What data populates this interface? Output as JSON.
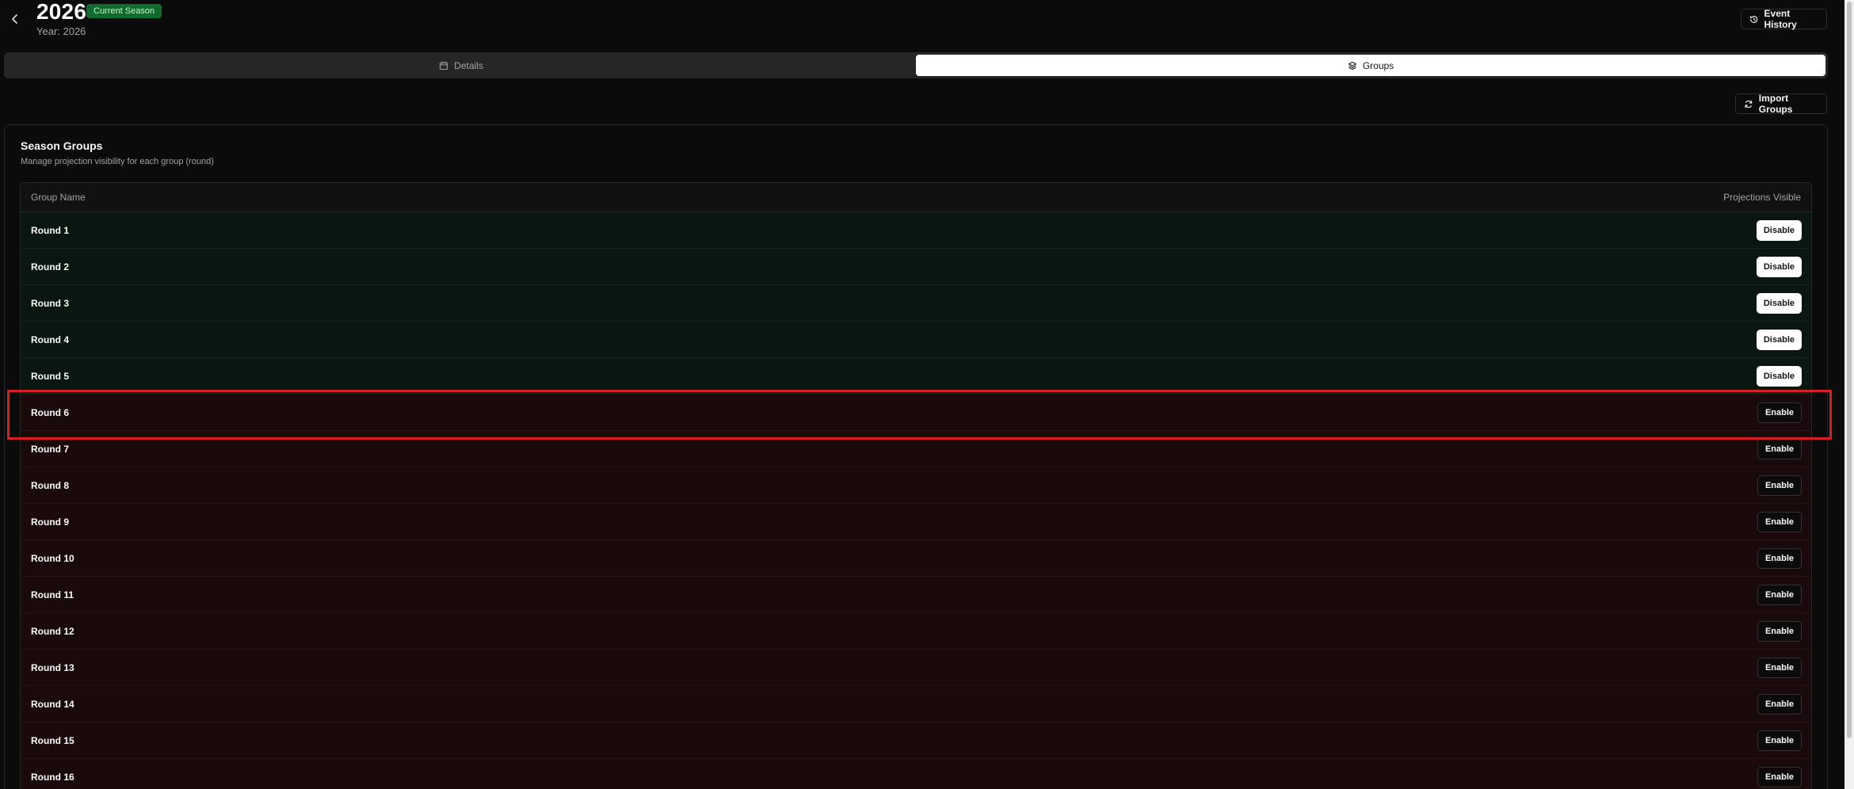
{
  "header": {
    "title": "2026",
    "badge": "Current Season",
    "subtitle": "Year: 2026",
    "event_history_label": "Event History"
  },
  "tabs": [
    {
      "label": "Details",
      "icon": "calendar-icon",
      "active": false
    },
    {
      "label": "Groups",
      "icon": "layers-icon",
      "active": true
    }
  ],
  "import_groups_label": "Import Groups",
  "card": {
    "title": "Season Groups",
    "description": "Manage projection visibility for each group (round)"
  },
  "table": {
    "col_name": "Group Name",
    "col_visible": "Projections Visible",
    "rows": [
      {
        "name": "Round 1",
        "action": "Disable"
      },
      {
        "name": "Round 2",
        "action": "Disable"
      },
      {
        "name": "Round 3",
        "action": "Disable"
      },
      {
        "name": "Round 4",
        "action": "Disable"
      },
      {
        "name": "Round 5",
        "action": "Disable"
      },
      {
        "name": "Round 6",
        "action": "Enable"
      },
      {
        "name": "Round 7",
        "action": "Enable"
      },
      {
        "name": "Round 8",
        "action": "Enable"
      },
      {
        "name": "Round 9",
        "action": "Enable"
      },
      {
        "name": "Round 10",
        "action": "Enable"
      },
      {
        "name": "Round 11",
        "action": "Enable"
      },
      {
        "name": "Round 12",
        "action": "Enable"
      },
      {
        "name": "Round 13",
        "action": "Enable"
      },
      {
        "name": "Round 14",
        "action": "Enable"
      },
      {
        "name": "Round 15",
        "action": "Enable"
      },
      {
        "name": "Round 16",
        "action": "Enable"
      }
    ]
  },
  "colors": {
    "background": "#0b0b0b",
    "badge": "#0f6b2e",
    "row_enabled": "#0a1710",
    "row_disabled": "#1b0a0b",
    "highlight": "#d81f26"
  }
}
